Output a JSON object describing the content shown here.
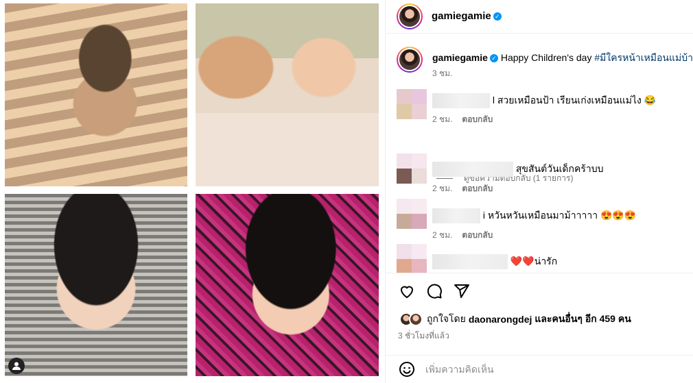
{
  "post": {
    "username": "gamiegamie",
    "caption_text": "Happy Children's day",
    "caption_hashtag": "#มีใครหน้าเหมือนแม่บ้าง",
    "caption_time": "3 ชม."
  },
  "comments": [
    {
      "text": "l สวยเหมือนป้า เรียนเก่งเหมือนแม่ไง 😂",
      "time": "2 ชม.",
      "reply_label": "ตอบกลับ",
      "avatar_colors": [
        "#e7c9cb",
        "#e9c6df",
        "#dfc9a6",
        "#ead0d4"
      ]
    },
    {
      "text": "สุขสันต์วันเด็กคร้าบบ",
      "time": "2 ชม.",
      "reply_label": "ตอบกลับ",
      "avatar_colors": [
        "#f3e1ea",
        "#f6e6ee",
        "#7a5a53",
        "#e9dcd9"
      ]
    },
    {
      "text": "i หวันหวันเหมือนมาม้าาาาา 😍😍😍",
      "time": "2 ชม.",
      "reply_label": "ตอบกลับ",
      "avatar_colors": [
        "#f5e8ee",
        "#f7eaf0",
        "#c8aa9a",
        "#d8a9b8"
      ]
    },
    {
      "text": "❤️❤️น่ารัก",
      "avatar_colors": [
        "#f1e0ea",
        "#f7e9f1",
        "#e0a98e",
        "#e7b6c0"
      ]
    }
  ],
  "view_replies": "ดูข้อความตอบกลับ (1 รายการ)",
  "likes": {
    "prefix": "ถูกใจโดย",
    "user": "daonarongdej",
    "suffix": "และคนอื่นๆ อีก 459 คน"
  },
  "posted_ago": "3 ชั่วโมงที่แล้ว",
  "add_comment": {
    "placeholder": "เพิ่มความคิดเห็น"
  },
  "colors": {
    "link": "#00376b",
    "verified": "#0095f6",
    "muted": "#737373"
  },
  "icons": [
    "heart-icon",
    "comment-icon",
    "share-icon",
    "emoji-icon",
    "user-tag-icon",
    "verified-badge-icon"
  ]
}
